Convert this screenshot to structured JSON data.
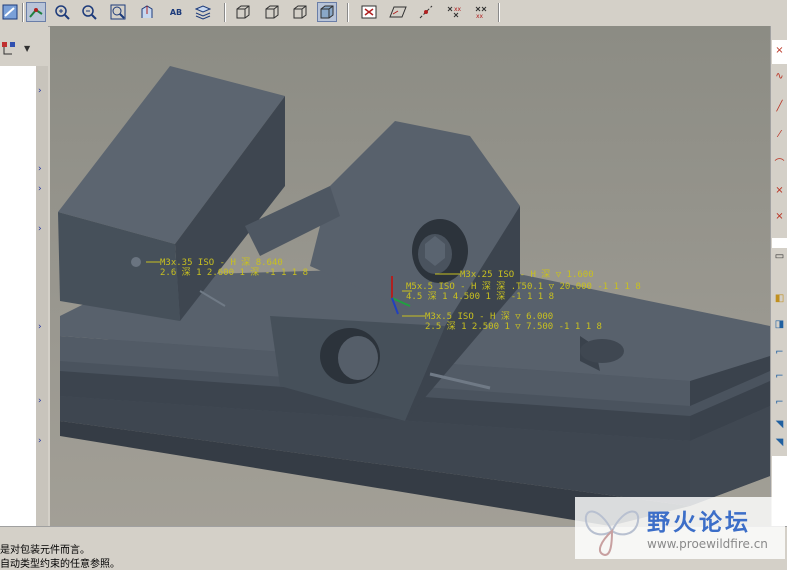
{
  "toolbar": {
    "icons": [
      "select-icon",
      "sketch-point-icon",
      "zoom-in-icon",
      "zoom-out-icon",
      "refit-icon",
      "orient-icon",
      "saved-views-icon",
      "layers-icon",
      "wireframe-icon",
      "hidden-line-icon",
      "no-hidden-icon",
      "shading-icon",
      "annotation-display-icon",
      "datum-plane-icon",
      "datum-axis-icon",
      "datum-point-icon",
      "csys-icon"
    ],
    "saved_views_label": "AB"
  },
  "dimensions": [
    {
      "line1": "M3x.35 ISO - H 深 8.640",
      "line2": "2.6 深 1 2.600 1 深 -1 1 1 8"
    },
    {
      "line1": "M3x.25 ISO - H 深 ▽ 1.600",
      "line2": ""
    },
    {
      "line1": "M5x.5 ISO - H 深 深 .T50.1 ▽ 20.000 -1 1 1 8",
      "line2": "4.5 深 1 4.500 1 深 -1 1 1 8"
    },
    {
      "line1": "M3x.5 ISO - H 深 ▽ 6.000",
      "line2": "2.5 深 1 2.500 1 ▽ 7.500 -1 1 1 8"
    }
  ],
  "status": {
    "line1": "是对包装元件而言。",
    "line2": "自动类型约束的任意参照。"
  },
  "watermark": {
    "title": "野火论坛",
    "url": "www.proewildfire.cn"
  },
  "colors": {
    "viewport_bg": "#9a9890",
    "model": "#4c5560",
    "dimension_text": "#c8c020"
  }
}
